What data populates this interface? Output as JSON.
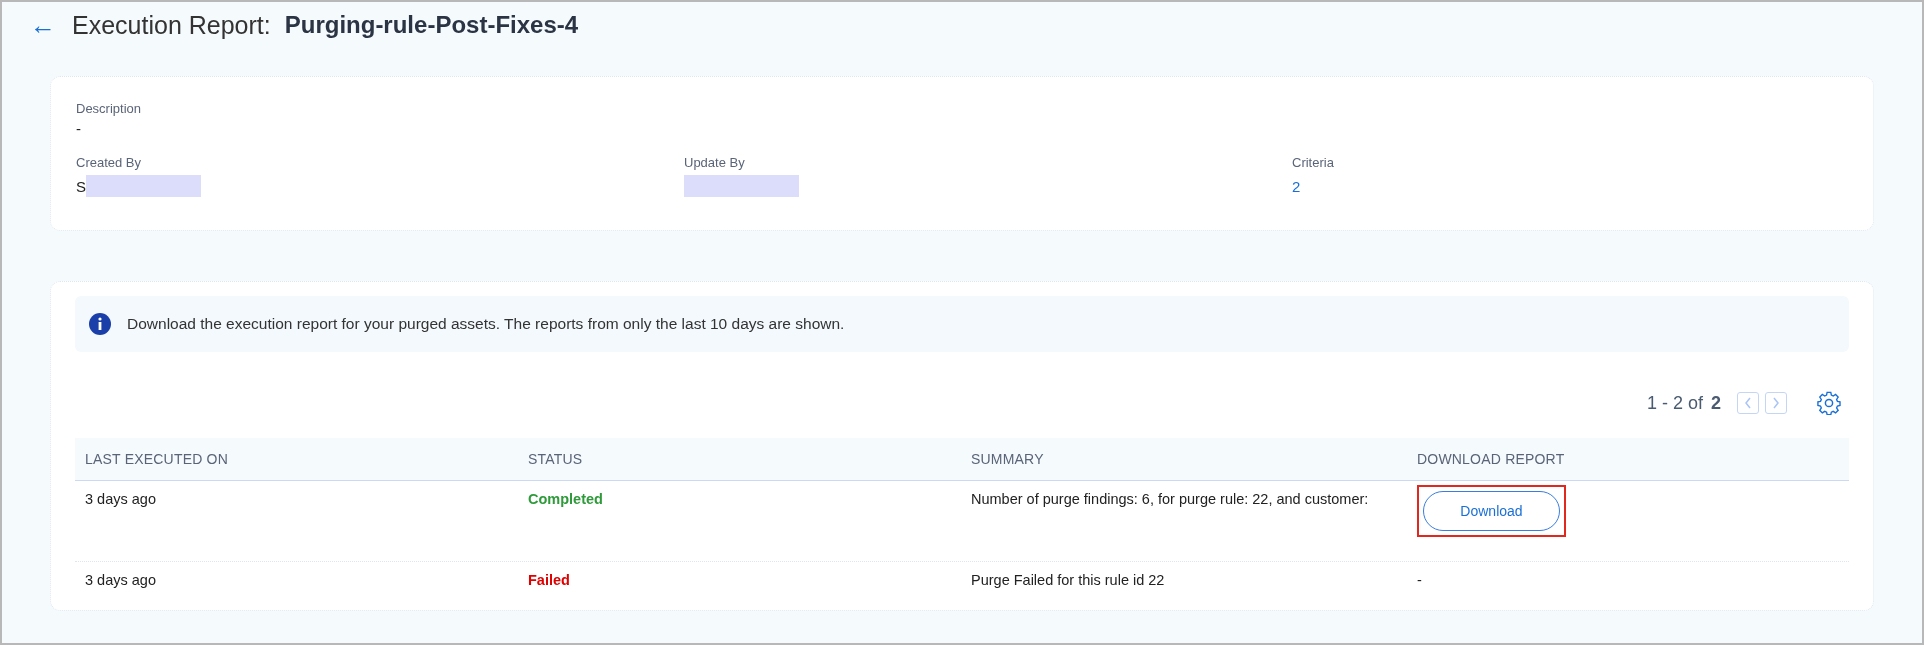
{
  "header": {
    "back_icon": "←",
    "label": "Execution Report:",
    "name": "Purging-rule-Post-Fixes-4"
  },
  "details": {
    "description": {
      "label": "Description",
      "value": "-"
    },
    "fields": [
      {
        "label": "Created By",
        "value": "S",
        "redacted": true,
        "kind": "text"
      },
      {
        "label": "Update By",
        "redacted": true,
        "kind": "text"
      },
      {
        "label": "Criteria",
        "value": "2",
        "redacted": false,
        "kind": "link"
      }
    ]
  },
  "notice": "Download the execution report for your purged assets. The reports from only the last 10 days are shown.",
  "pagination": {
    "range": "1 - 2 of",
    "total": "2"
  },
  "table": {
    "columns": [
      "LAST EXECUTED ON",
      "STATUS",
      "SUMMARY",
      "DOWNLOAD REPORT"
    ],
    "rows": [
      {
        "last_executed": "3 days ago",
        "status": "Completed",
        "color": "#2e9a3a",
        "summary": "Number of purge findings: 6, for purge rule: 22, and customer:",
        "download": {
          "kind": "button",
          "label": "Download",
          "highlighted": true
        }
      },
      {
        "last_executed": "3 days ago",
        "status": "Failed",
        "color": "#e00000",
        "summary": "Purge Failed for this rule id 22",
        "download": {
          "kind": "text",
          "label": "-",
          "highlighted": false
        }
      }
    ]
  }
}
